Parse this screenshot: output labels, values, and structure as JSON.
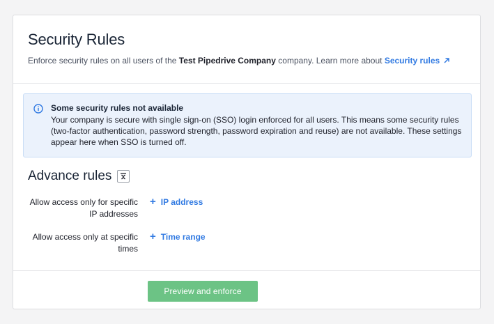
{
  "header": {
    "title": "Security Rules",
    "subtitle_prefix": "Enforce security rules on all users of the ",
    "company_name": "Test Pipedrive Company",
    "subtitle_middle": " company. Learn more about ",
    "learn_more_link": "Security rules"
  },
  "alert": {
    "title": "Some security rules not available",
    "body": "Your company is secure with single sign-on (SSO) login enforced for all users. This means some security rules (two-factor authentication, password strength, password expiration and reuse) are not available. These settings appear here when SSO is turned off.",
    "icon": "info-icon"
  },
  "advanced": {
    "heading": "Advance rules",
    "rules": [
      {
        "label": "Allow access only for specific IP addresses",
        "action": "IP address"
      },
      {
        "label": "Allow access only at specific times",
        "action": "Time range"
      }
    ]
  },
  "footer": {
    "primary_button": "Preview and enforce"
  },
  "colors": {
    "accent": "#317ae2",
    "primary_button": "#6cc385",
    "alert_bg": "#ebf2fc"
  }
}
